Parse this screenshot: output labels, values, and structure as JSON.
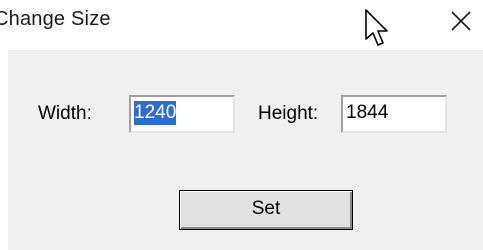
{
  "window": {
    "title": "Change Size",
    "close_icon": "close-icon"
  },
  "form": {
    "width_label": "Width:",
    "width_value": "1240",
    "height_label": "Height:",
    "height_value": "1844"
  },
  "buttons": {
    "set_label": "Set"
  },
  "colors": {
    "dialog_background": "#f0f0f0",
    "selection": "#2f6ccf"
  }
}
